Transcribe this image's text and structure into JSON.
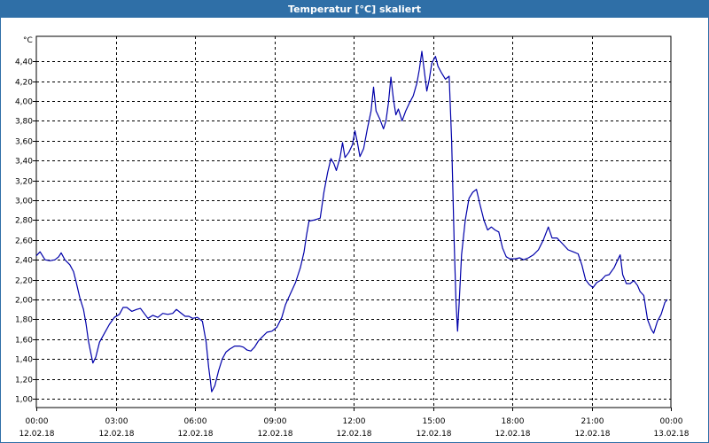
{
  "window": {
    "title": "Temperatur [°C] skaliert"
  },
  "chart_data": {
    "type": "line",
    "title": "Temperatur [°C] skaliert",
    "y_unit_label": "°C",
    "ylim": [
      1.0,
      4.6
    ],
    "xlim_hours": [
      0,
      24
    ],
    "grid": true,
    "y_ticks": [
      "1,00",
      "1,20",
      "1,40",
      "1,60",
      "1,80",
      "2,00",
      "2,20",
      "2,40",
      "2,60",
      "2,80",
      "3,00",
      "3,20",
      "3,40",
      "3,60",
      "3,80",
      "4,00",
      "4,20",
      "4,40"
    ],
    "x_ticks": [
      {
        "time": "00:00",
        "date": "12.02.18"
      },
      {
        "time": "03:00",
        "date": "12.02.18"
      },
      {
        "time": "06:00",
        "date": "12.02.18"
      },
      {
        "time": "09:00",
        "date": "12.02.18"
      },
      {
        "time": "12:00",
        "date": "12.02.18"
      },
      {
        "time": "15:00",
        "date": "12.02.18"
      },
      {
        "time": "18:00",
        "date": "12.02.18"
      },
      {
        "time": "21:00",
        "date": "12.02.18"
      },
      {
        "time": "00:00",
        "date": "13.02.18"
      }
    ],
    "series": [
      {
        "color": "#0000aa",
        "points": [
          [
            0.0,
            2.44
          ],
          [
            0.15,
            2.48
          ],
          [
            0.35,
            2.4
          ],
          [
            0.55,
            2.39
          ],
          [
            0.75,
            2.4
          ],
          [
            0.9,
            2.43
          ],
          [
            1.0,
            2.47
          ],
          [
            1.15,
            2.4
          ],
          [
            1.35,
            2.35
          ],
          [
            1.5,
            2.28
          ],
          [
            1.6,
            2.18
          ],
          [
            1.75,
            2.02
          ],
          [
            1.9,
            1.9
          ],
          [
            2.0,
            1.76
          ],
          [
            2.1,
            1.58
          ],
          [
            2.2,
            1.46
          ],
          [
            2.28,
            1.36
          ],
          [
            2.4,
            1.42
          ],
          [
            2.55,
            1.57
          ],
          [
            2.75,
            1.66
          ],
          [
            2.95,
            1.75
          ],
          [
            3.15,
            1.82
          ],
          [
            3.35,
            1.85
          ],
          [
            3.5,
            1.92
          ],
          [
            3.65,
            1.92
          ],
          [
            3.85,
            1.88
          ],
          [
            4.05,
            1.9
          ],
          [
            4.2,
            1.91
          ],
          [
            4.35,
            1.86
          ],
          [
            4.5,
            1.81
          ],
          [
            4.7,
            1.84
          ],
          [
            4.9,
            1.82
          ],
          [
            5.1,
            1.86
          ],
          [
            5.3,
            1.85
          ],
          [
            5.5,
            1.86
          ],
          [
            5.65,
            1.9
          ],
          [
            5.8,
            1.87
          ],
          [
            6.0,
            1.83
          ],
          [
            6.15,
            1.83
          ],
          [
            6.3,
            1.81
          ],
          [
            6.5,
            1.82
          ],
          [
            6.7,
            1.78
          ],
          [
            6.85,
            1.57
          ],
          [
            6.95,
            1.32
          ],
          [
            7.02,
            1.18
          ],
          [
            7.07,
            1.07
          ],
          [
            7.2,
            1.13
          ],
          [
            7.35,
            1.28
          ],
          [
            7.5,
            1.4
          ],
          [
            7.65,
            1.47
          ],
          [
            7.8,
            1.5
          ],
          [
            8.0,
            1.53
          ],
          [
            8.2,
            1.53
          ],
          [
            8.35,
            1.52
          ],
          [
            8.5,
            1.49
          ],
          [
            8.65,
            1.48
          ],
          [
            8.8,
            1.52
          ],
          [
            8.95,
            1.58
          ],
          [
            9.1,
            1.62
          ],
          [
            9.3,
            1.67
          ],
          [
            9.5,
            1.68
          ],
          [
            9.7,
            1.72
          ],
          [
            9.9,
            1.82
          ],
          [
            10.05,
            1.95
          ],
          [
            10.25,
            2.06
          ],
          [
            10.45,
            2.17
          ],
          [
            10.65,
            2.32
          ],
          [
            10.8,
            2.48
          ],
          [
            10.9,
            2.65
          ],
          [
            11.0,
            2.79
          ],
          [
            11.2,
            2.8
          ],
          [
            11.45,
            2.82
          ],
          [
            11.6,
            3.08
          ],
          [
            11.75,
            3.28
          ],
          [
            11.88,
            3.42
          ],
          [
            12.0,
            3.37
          ],
          [
            12.1,
            3.3
          ],
          [
            12.25,
            3.43
          ],
          [
            12.35,
            3.58
          ],
          [
            12.45,
            3.43
          ],
          [
            12.6,
            3.48
          ],
          [
            12.75,
            3.56
          ],
          [
            12.85,
            3.7
          ],
          [
            12.95,
            3.58
          ],
          [
            13.05,
            3.44
          ],
          [
            13.2,
            3.52
          ],
          [
            13.35,
            3.72
          ],
          [
            13.5,
            3.9
          ],
          [
            13.6,
            4.14
          ],
          [
            13.7,
            3.9
          ],
          [
            13.85,
            3.82
          ],
          [
            14.0,
            3.72
          ],
          [
            14.1,
            3.8
          ],
          [
            14.2,
            3.98
          ],
          [
            14.3,
            4.24
          ],
          [
            14.4,
            4.02
          ],
          [
            14.5,
            3.86
          ],
          [
            14.6,
            3.92
          ],
          [
            14.75,
            3.8
          ],
          [
            14.9,
            3.9
          ],
          [
            15.05,
            3.98
          ],
          [
            15.2,
            4.05
          ],
          [
            15.35,
            4.18
          ],
          [
            15.45,
            4.32
          ],
          [
            15.55,
            4.5
          ],
          [
            15.65,
            4.3
          ],
          [
            15.75,
            4.1
          ],
          [
            15.85,
            4.22
          ],
          [
            15.95,
            4.38
          ],
          [
            16.1,
            4.45
          ],
          [
            16.2,
            4.35
          ],
          [
            16.35,
            4.28
          ],
          [
            16.5,
            4.22
          ],
          [
            16.65,
            4.25
          ],
          [
            16.75,
            3.6
          ],
          [
            16.85,
            2.6
          ],
          [
            16.92,
            2.0
          ],
          [
            16.99,
            1.68
          ],
          [
            17.05,
            1.95
          ],
          [
            17.15,
            2.45
          ],
          [
            17.3,
            2.8
          ],
          [
            17.45,
            3.02
          ],
          [
            17.6,
            3.08
          ],
          [
            17.75,
            3.11
          ],
          [
            17.9,
            2.95
          ],
          [
            18.05,
            2.8
          ],
          [
            18.2,
            2.7
          ],
          [
            18.35,
            2.73
          ],
          [
            18.5,
            2.7
          ],
          [
            18.65,
            2.68
          ],
          [
            18.8,
            2.52
          ],
          [
            18.95,
            2.43
          ],
          [
            19.1,
            2.41
          ],
          [
            19.3,
            2.41
          ],
          [
            19.5,
            2.42
          ],
          [
            19.65,
            2.4
          ],
          [
            19.85,
            2.42
          ],
          [
            20.05,
            2.45
          ],
          [
            20.25,
            2.5
          ],
          [
            20.45,
            2.6
          ],
          [
            20.65,
            2.73
          ],
          [
            20.8,
            2.62
          ],
          [
            21.0,
            2.62
          ],
          [
            21.15,
            2.58
          ],
          [
            21.3,
            2.54
          ],
          [
            21.45,
            2.5
          ],
          [
            21.65,
            2.48
          ],
          [
            21.85,
            2.46
          ],
          [
            22.0,
            2.35
          ],
          [
            22.15,
            2.2
          ],
          [
            22.3,
            2.15
          ],
          [
            22.45,
            2.12
          ],
          [
            22.6,
            2.17
          ],
          [
            22.8,
            2.2
          ],
          [
            22.95,
            2.24
          ],
          [
            23.1,
            2.25
          ],
          [
            23.3,
            2.32
          ],
          [
            23.45,
            2.4
          ],
          [
            23.55,
            2.45
          ],
          [
            23.65,
            2.25
          ],
          [
            23.8,
            2.16
          ],
          [
            23.95,
            2.16
          ],
          [
            24.1,
            2.19
          ],
          [
            24.25,
            2.14
          ],
          [
            24.35,
            2.08
          ],
          [
            24.5,
            2.04
          ],
          [
            24.65,
            1.8
          ],
          [
            24.8,
            1.7
          ],
          [
            24.9,
            1.66
          ],
          [
            25.05,
            1.78
          ],
          [
            25.2,
            1.85
          ],
          [
            25.35,
            1.97
          ],
          [
            25.45,
            2.0
          ]
        ]
      }
    ]
  }
}
